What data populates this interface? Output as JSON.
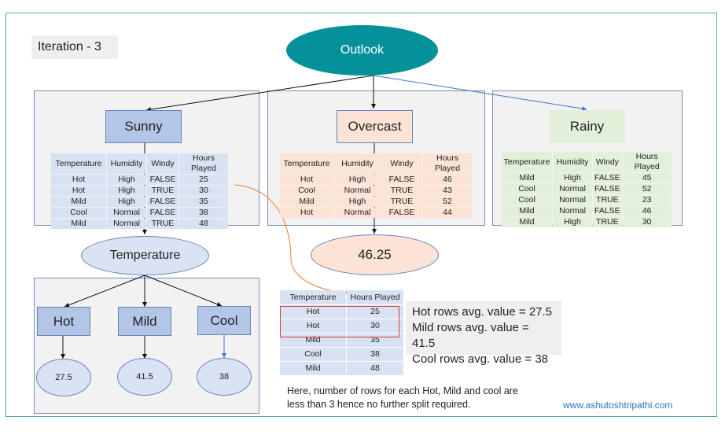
{
  "iteration_label": "Iteration - 3",
  "root": {
    "label": "Outlook",
    "color": "#049199"
  },
  "branches": {
    "sunny": {
      "label": "Sunny",
      "table": {
        "headers": [
          "Temperature",
          "Humidity",
          "Windy",
          "Hours Played"
        ],
        "rows": [
          [
            "Hot",
            "High",
            "FALSE",
            "25"
          ],
          [
            "Hot",
            "High",
            "TRUE",
            "30"
          ],
          [
            "Mild",
            "High",
            "FALSE",
            "35"
          ],
          [
            "Cool",
            "Normal",
            "FALSE",
            "38"
          ],
          [
            "Mild",
            "Normal",
            "TRUE",
            "48"
          ]
        ]
      }
    },
    "overcast": {
      "label": "Overcast",
      "leaf_value": "46.25",
      "table": {
        "headers": [
          "Temperature",
          "Humidity",
          "Windy",
          "Hours Played"
        ],
        "rows": [
          [
            "Hot",
            "High",
            "FALSE",
            "46"
          ],
          [
            "Cool",
            "Normal",
            "TRUE",
            "43"
          ],
          [
            "Mild",
            "High",
            "TRUE",
            "52"
          ],
          [
            "Hot",
            "Normal",
            "FALSE",
            "44"
          ]
        ]
      }
    },
    "rainy": {
      "label": "Rainy",
      "table": {
        "headers": [
          "Temperature",
          "Humidity",
          "Windy",
          "Hours Played"
        ],
        "rows": [
          [
            "Mild",
            "High",
            "FALSE",
            "45"
          ],
          [
            "Cool",
            "Normal",
            "FALSE",
            "52"
          ],
          [
            "Cool",
            "Normal",
            "TRUE",
            "23"
          ],
          [
            "Mild",
            "Normal",
            "FALSE",
            "46"
          ],
          [
            "Mild",
            "High",
            "TRUE",
            "30"
          ]
        ]
      }
    }
  },
  "temperature_node": {
    "label": "Temperature",
    "children": [
      {
        "label": "Hot",
        "leaf_value": "27.5"
      },
      {
        "label": "Mild",
        "leaf_value": "41.5"
      },
      {
        "label": "Cool",
        "leaf_value": "38"
      }
    ]
  },
  "subset_table": {
    "headers": [
      "Temperature",
      "Hours Played"
    ],
    "rows": [
      [
        "Hot",
        "25"
      ],
      [
        "Hot",
        "30"
      ],
      [
        "Mild",
        "35"
      ],
      [
        "Cool",
        "38"
      ],
      [
        "Mild",
        "48"
      ]
    ],
    "highlight_color": "#e03c3c"
  },
  "averages": [
    "Hot rows avg. value = 27.5",
    "Mild rows avg. value = 41.5",
    "Cool rows avg. value = 38"
  ],
  "note_lines": [
    "Here, number of rows for each Hot, Mild and cool are",
    "less than 3 hence no further split required."
  ],
  "website": "www.ashutoshtripathi.com"
}
